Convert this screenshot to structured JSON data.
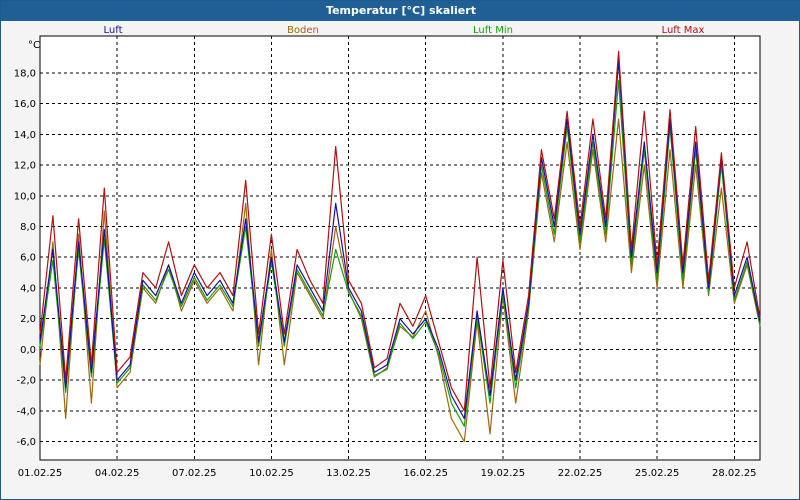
{
  "title": "Temperatur [°C] skaliert",
  "colors": {
    "titlebar": "#1f5f96",
    "luft": "#1a10a0",
    "boden": "#a0660a",
    "luft_min": "#12a012",
    "luft_max": "#b01010"
  },
  "chart_data": {
    "type": "line",
    "title": "Temperatur [°C] skaliert",
    "xlabel": "",
    "ylabel": "°C",
    "ylim": [
      -7.2,
      20.4
    ],
    "grid": true,
    "legend_position": "top",
    "y_ticks": [
      "18,0",
      "16,0",
      "14,0",
      "12,0",
      "10,0",
      "8,0",
      "6,0",
      "4,0",
      "2,0",
      "0,0",
      "-2,0",
      "-4,0",
      "-6,0"
    ],
    "x_ticks": [
      "01.02.25",
      "04.02.25",
      "07.02.25",
      "10.02.25",
      "13.02.25",
      "16.02.25",
      "19.02.25",
      "22.02.25",
      "25.02.25",
      "28.02.25"
    ],
    "x_start": "01.02.25",
    "x_end": "01.03.25",
    "x": [
      "01.02.25 00:00",
      "01.02.25 12:00",
      "02.02.25 00:00",
      "02.02.25 12:00",
      "03.02.25 00:00",
      "03.02.25 12:00",
      "04.02.25 00:00",
      "04.02.25 12:00",
      "05.02.25 00:00",
      "05.02.25 12:00",
      "06.02.25 00:00",
      "06.02.25 12:00",
      "07.02.25 00:00",
      "07.02.25 12:00",
      "08.02.25 00:00",
      "08.02.25 12:00",
      "09.02.25 00:00",
      "09.02.25 12:00",
      "10.02.25 00:00",
      "10.02.25 12:00",
      "11.02.25 00:00",
      "11.02.25 12:00",
      "12.02.25 00:00",
      "12.02.25 12:00",
      "13.02.25 00:00",
      "13.02.25 12:00",
      "14.02.25 00:00",
      "14.02.25 12:00",
      "15.02.25 00:00",
      "15.02.25 12:00",
      "16.02.25 00:00",
      "16.02.25 12:00",
      "17.02.25 00:00",
      "17.02.25 12:00",
      "18.02.25 00:00",
      "18.02.25 12:00",
      "19.02.25 00:00",
      "19.02.25 12:00",
      "20.02.25 00:00",
      "20.02.25 12:00",
      "21.02.25 00:00",
      "21.02.25 12:00",
      "22.02.25 00:00",
      "22.02.25 12:00",
      "23.02.25 00:00",
      "23.02.25 12:00",
      "24.02.25 00:00",
      "24.02.25 12:00",
      "25.02.25 00:00",
      "25.02.25 12:00",
      "26.02.25 00:00",
      "26.02.25 12:00",
      "27.02.25 00:00",
      "27.02.25 12:00",
      "28.02.25 00:00",
      "28.02.25 12:00",
      "01.03.25 00:00"
    ],
    "series": [
      {
        "name": "Luft",
        "values": [
          0.5,
          6.5,
          -2.5,
          7.0,
          -1.5,
          7.8,
          -2.0,
          -1.0,
          4.5,
          3.5,
          5.5,
          3.0,
          5.0,
          3.5,
          4.5,
          3.0,
          8.5,
          0.5,
          6.0,
          0.5,
          5.5,
          4.0,
          2.5,
          9.5,
          4.0,
          2.5,
          -1.5,
          -1.0,
          2.0,
          1.0,
          2.0,
          0.0,
          -3.0,
          -4.5,
          2.5,
          -3.0,
          4.0,
          -2.0,
          3.0,
          12.5,
          8.0,
          15.0,
          7.5,
          14.0,
          8.0,
          18.8,
          6.0,
          13.5,
          5.0,
          15.0,
          5.0,
          13.5,
          4.0,
          12.5,
          3.5,
          6.0,
          1.8
        ]
      },
      {
        "name": "Boden",
        "values": [
          -1.0,
          7.0,
          -4.5,
          7.5,
          -3.5,
          9.0,
          -2.5,
          -1.5,
          4.0,
          3.0,
          5.5,
          2.5,
          4.5,
          3.0,
          4.0,
          2.5,
          9.5,
          -1.0,
          6.5,
          -1.0,
          5.0,
          3.5,
          2.0,
          8.0,
          3.8,
          2.0,
          -1.8,
          -1.2,
          1.5,
          0.8,
          2.5,
          -0.5,
          -4.5,
          -6.0,
          1.8,
          -5.5,
          3.5,
          -3.5,
          2.5,
          11.5,
          7.0,
          13.5,
          6.5,
          13.0,
          7.0,
          15.0,
          5.0,
          12.0,
          4.0,
          13.0,
          4.0,
          12.0,
          3.5,
          10.5,
          3.0,
          5.5,
          1.5
        ]
      },
      {
        "name": "Luft Min",
        "values": [
          0.2,
          5.8,
          -2.8,
          6.5,
          -1.8,
          7.2,
          -2.2,
          -1.2,
          4.2,
          3.2,
          5.2,
          2.8,
          4.7,
          3.2,
          4.2,
          2.8,
          8.0,
          0.2,
          5.7,
          0.2,
          5.2,
          3.7,
          2.2,
          6.5,
          3.7,
          2.2,
          -1.7,
          -1.3,
          1.7,
          0.7,
          1.8,
          -0.3,
          -3.5,
          -5.0,
          2.2,
          -3.5,
          3.7,
          -2.5,
          2.7,
          12.0,
          7.5,
          14.5,
          7.0,
          13.5,
          7.5,
          17.5,
          5.5,
          13.0,
          4.5,
          14.5,
          4.5,
          13.0,
          3.7,
          12.0,
          3.2,
          5.7,
          1.6
        ]
      },
      {
        "name": "Luft Max",
        "values": [
          1.0,
          8.7,
          -2.0,
          8.5,
          -1.0,
          10.5,
          -1.5,
          -0.5,
          5.0,
          4.0,
          7.0,
          3.5,
          5.5,
          4.0,
          5.0,
          3.5,
          11.0,
          1.0,
          7.5,
          1.0,
          6.5,
          4.5,
          3.0,
          13.2,
          4.5,
          3.0,
          -1.2,
          -0.6,
          3.0,
          1.5,
          3.5,
          0.5,
          -2.5,
          -4.0,
          6.0,
          -2.5,
          5.8,
          -1.5,
          3.5,
          13.0,
          8.5,
          15.5,
          8.0,
          15.0,
          8.5,
          19.4,
          6.5,
          15.5,
          5.5,
          15.6,
          5.5,
          14.5,
          4.5,
          12.8,
          4.0,
          7.0,
          2.0
        ]
      }
    ]
  }
}
